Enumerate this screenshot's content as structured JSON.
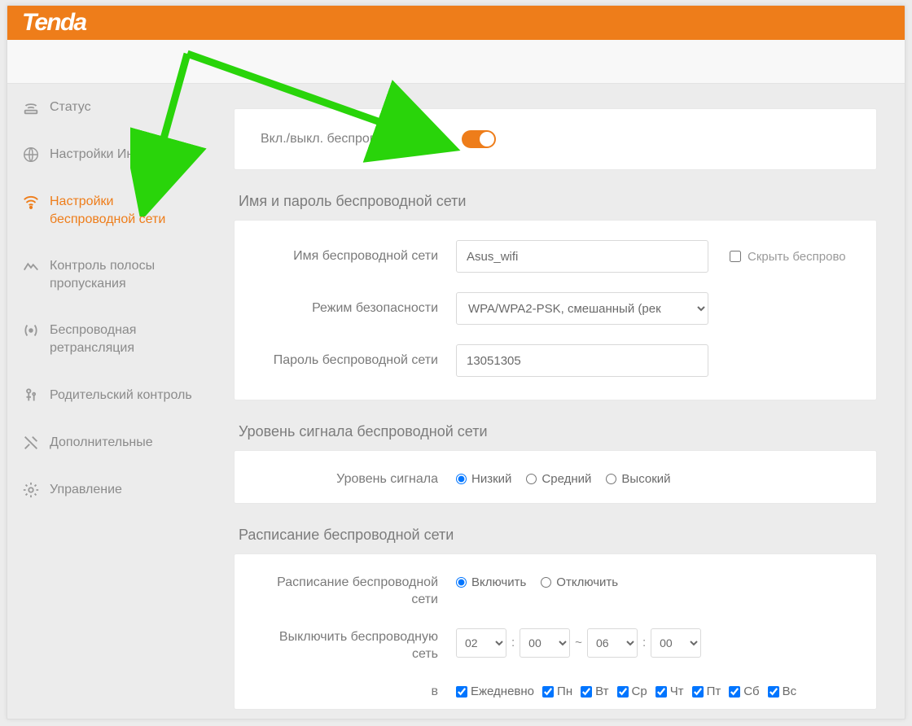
{
  "brand": "Tenda",
  "sidebar": {
    "items": [
      {
        "label": "Статус",
        "icon": "status-icon"
      },
      {
        "label": "Настройки Интернета",
        "icon": "globe-icon"
      },
      {
        "label": "Настройки беспроводной сети",
        "icon": "wifi-icon",
        "active": true
      },
      {
        "label": "Контроль полосы пропускания",
        "icon": "bandwidth-icon"
      },
      {
        "label": "Беспроводная ретрансляция",
        "icon": "repeater-icon"
      },
      {
        "label": "Родительский контроль",
        "icon": "parental-icon"
      },
      {
        "label": "Дополнительные",
        "icon": "tools-icon"
      },
      {
        "label": "Управление",
        "icon": "gear-icon"
      }
    ]
  },
  "wireless": {
    "enable_label": "Вкл./выкл. беспроводную сеть",
    "enabled": true,
    "section1_title": "Имя и пароль беспроводной сети",
    "ssid_label": "Имя беспроводной сети",
    "ssid_value": "Asus_wifi",
    "hide_ssid_label": "Скрыть беспрово",
    "hide_ssid_checked": false,
    "security_label": "Режим безопасности",
    "security_value": "WPA/WPA2-PSK, смешанный (рек",
    "password_label": "Пароль беспроводной сети",
    "password_value": "13051305",
    "section2_title": "Уровень сигнала беспроводной сети",
    "signal_label": "Уровень сигнала",
    "signal_options": [
      "Низкий",
      "Средний",
      "Высокий"
    ],
    "signal_selected": "Низкий",
    "section3_title": "Расписание беспроводной сети",
    "schedule_label": "Расписание беспроводной сети",
    "schedule_options": [
      "Включить",
      "Отключить"
    ],
    "schedule_selected": "Включить",
    "disable_time_label": "Выключить беспроводную сеть",
    "time_from_h": "02",
    "time_from_m": "00",
    "time_to_h": "06",
    "time_to_m": "00",
    "time_range_sep": "~",
    "time_colon": ":",
    "days_prefix": "в",
    "days": [
      {
        "label": "Ежедневно",
        "checked": true
      },
      {
        "label": "Пн",
        "checked": true
      },
      {
        "label": "Вт",
        "checked": true
      },
      {
        "label": "Ср",
        "checked": true
      },
      {
        "label": "Чт",
        "checked": true
      },
      {
        "label": "Пт",
        "checked": true
      },
      {
        "label": "Сб",
        "checked": true
      },
      {
        "label": "Вс",
        "checked": true
      }
    ]
  },
  "colors": {
    "accent": "#ee7d1a",
    "annotation": "#29d40a"
  }
}
